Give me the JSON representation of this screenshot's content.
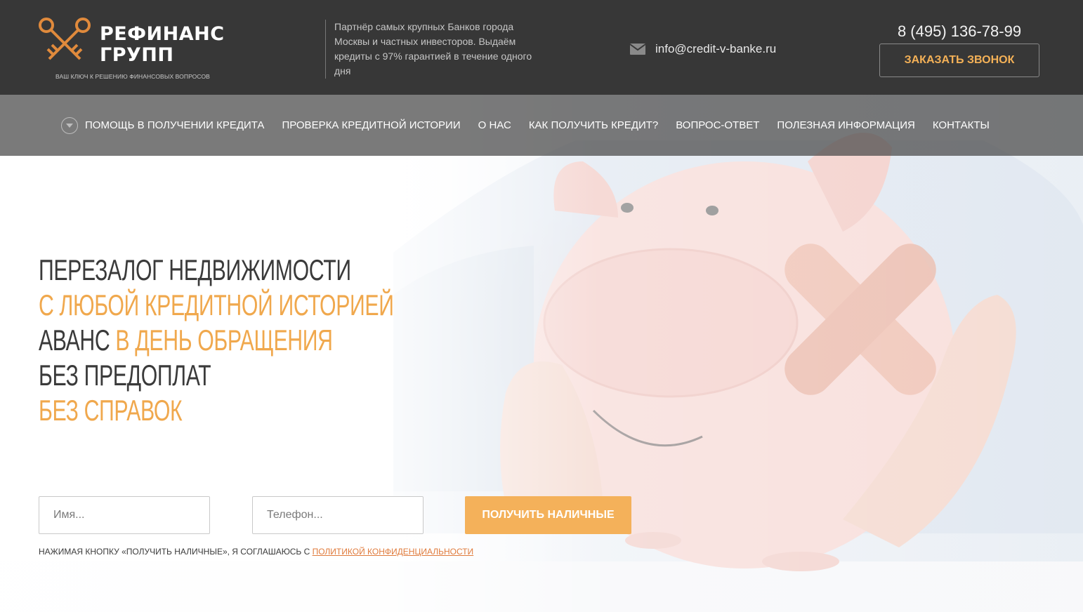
{
  "brand": {
    "title": "РЕФИНАНС\nГРУПП",
    "tagline": "ВАШ КЛЮЧ К РЕШЕНИЮ ФИНАНСОВЫХ ВОПРОСОВ",
    "logo_icon": "crossed-keys-icon"
  },
  "header": {
    "partner_text": "Партнёр самых крупных Банков города Москвы и частных инвесторов. Выдаём кредиты с 97% гарантией в течение одного дня",
    "email": "info@credit-v-banke.ru",
    "email_icon": "mail-icon",
    "phone": "8 (495) 136-78-99",
    "call_button_label": "ЗАКАЗАТЬ ЗВОНОК"
  },
  "nav": {
    "items": [
      {
        "label": "ПОМОЩЬ В ПОЛУЧЕНИИ КРЕДИТА",
        "has_dropdown": true
      },
      {
        "label": "ПРОВЕРКА КРЕДИТНОЙ ИСТОРИИ"
      },
      {
        "label": "О НАС"
      },
      {
        "label": "КАК ПОЛУЧИТЬ КРЕДИТ?"
      },
      {
        "label": "ВОПРОС-ОТВЕТ"
      },
      {
        "label": "ПОЛЕЗНАЯ ИНФОРМАЦИЯ"
      },
      {
        "label": "КОНТАКТЫ"
      }
    ]
  },
  "headline": {
    "line1": "ПЕРЕЗАЛОГ НЕДВИЖИМОСТИ",
    "line2": "С ЛЮБОЙ КРЕДИТНОЙ ИСТОРИЕЙ",
    "line3_dark": "АВАНС ",
    "line3_orange": "В ДЕНЬ ОБРАЩЕНИЯ",
    "line4": "БЕЗ ПРЕДОПЛАТ",
    "line5": "БЕЗ СПРАВОК"
  },
  "form": {
    "name_placeholder": "Имя...",
    "phone_placeholder": "Телефон...",
    "submit_label": "ПОЛУЧИТЬ НАЛИЧНЫЕ",
    "consent_text": "НАЖИМАЯ КНОПКУ «ПОЛУЧИТЬ НАЛИЧНЫЕ», Я СОГЛАШАЮСЬ С ",
    "consent_link": "ПОЛИТИКОЙ КОНФИДЕНЦИАЛЬНОСТИ"
  },
  "colors": {
    "header_bg": "#373737",
    "accent_orange": "#f4b15a",
    "text_dark": "#3a3a3a",
    "link_orange": "#e07b3c"
  }
}
